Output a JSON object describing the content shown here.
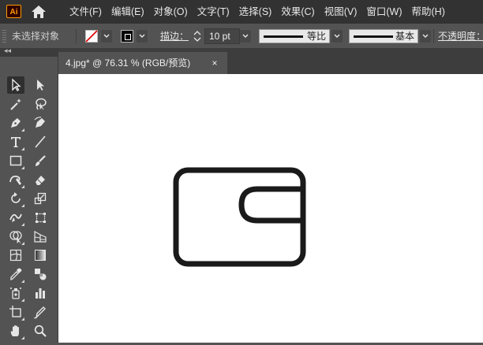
{
  "app": {
    "logo_text": "Ai"
  },
  "menu": {
    "items": [
      "文件(F)",
      "编辑(E)",
      "对象(O)",
      "文字(T)",
      "选择(S)",
      "效果(C)",
      "视图(V)",
      "窗口(W)",
      "帮助(H)"
    ]
  },
  "control_bar": {
    "selection_status": "未选择对象",
    "stroke_label": "描边：",
    "stroke_weight": "10 pt",
    "variable_width_profile": "等比",
    "brush_definition": "基本",
    "opacity_label": "不透明度："
  },
  "document": {
    "tab_title": "4.jpg* @ 76.31 % (RGB/预览)",
    "close_glyph": "×"
  },
  "panel_collapse_glyph": "◂◂",
  "colors": {
    "menubar_bg": "#323232",
    "panel_bg": "#535353",
    "canvas_bg": "#ffffff",
    "artwork_stroke": "#1a1a1a",
    "logo_accent": "#ff9a00"
  },
  "tools": [
    "selection-tool",
    "direct-selection-tool",
    "magic-wand-tool",
    "lasso-tool",
    "pen-tool",
    "curvature-tool",
    "type-tool",
    "line-segment-tool",
    "rectangle-tool",
    "paintbrush-tool",
    "shaper-tool",
    "eraser-tool",
    "rotate-tool",
    "scale-tool",
    "width-tool",
    "free-transform-tool",
    "shape-builder-tool",
    "perspective-grid-tool",
    "mesh-tool",
    "gradient-tool",
    "eyedropper-tool",
    "blend-tool",
    "symbol-sprayer-tool",
    "column-graph-tool",
    "artboard-tool",
    "slice-tool",
    "hand-tool",
    "zoom-tool"
  ]
}
